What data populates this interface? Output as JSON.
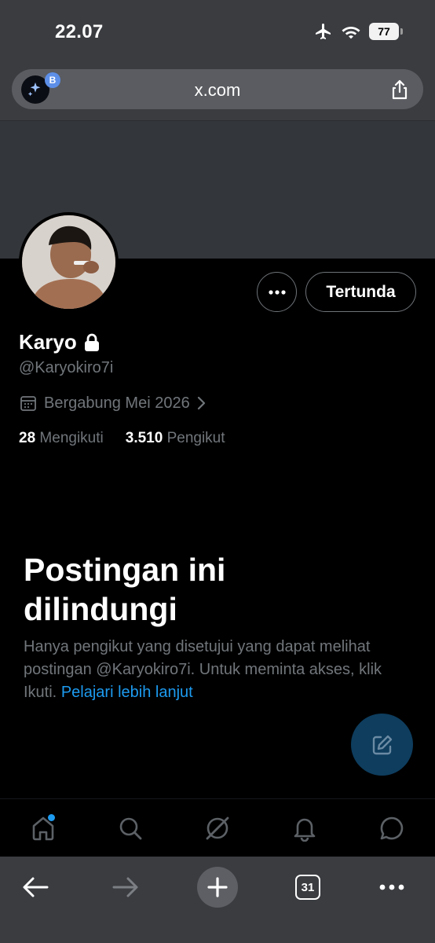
{
  "status_bar": {
    "time": "22.07",
    "battery": "77"
  },
  "browser": {
    "url": "x.com",
    "extension_badge": "B",
    "tabs_count": "31"
  },
  "profile": {
    "display_name": "Karyo",
    "handle": "@Karyokiro7i",
    "joined": "Bergabung Mei 2026",
    "following_count": "28",
    "following_label": "Mengikuti",
    "followers_count": "3.510",
    "followers_label": "Pengikut",
    "pending_button": "Tertunda"
  },
  "protected": {
    "title": "Postingan ini dilindungi",
    "description": "Hanya pengikut yang disetujui yang dapat melihat postingan @Karyokiro7i. Untuk meminta akses, klik Ikuti.",
    "learn_more": "Pelajari lebih lanjut"
  },
  "nav": {
    "items": [
      "home",
      "search",
      "grok",
      "notifications",
      "messages"
    ],
    "icons": [
      "home-icon",
      "search-icon",
      "grok-icon",
      "bell-icon",
      "chat-bubble-icon"
    ]
  },
  "colors": {
    "accent": "#1d9bf0",
    "muted": "#71767b",
    "fab": "#0e3d5e"
  }
}
